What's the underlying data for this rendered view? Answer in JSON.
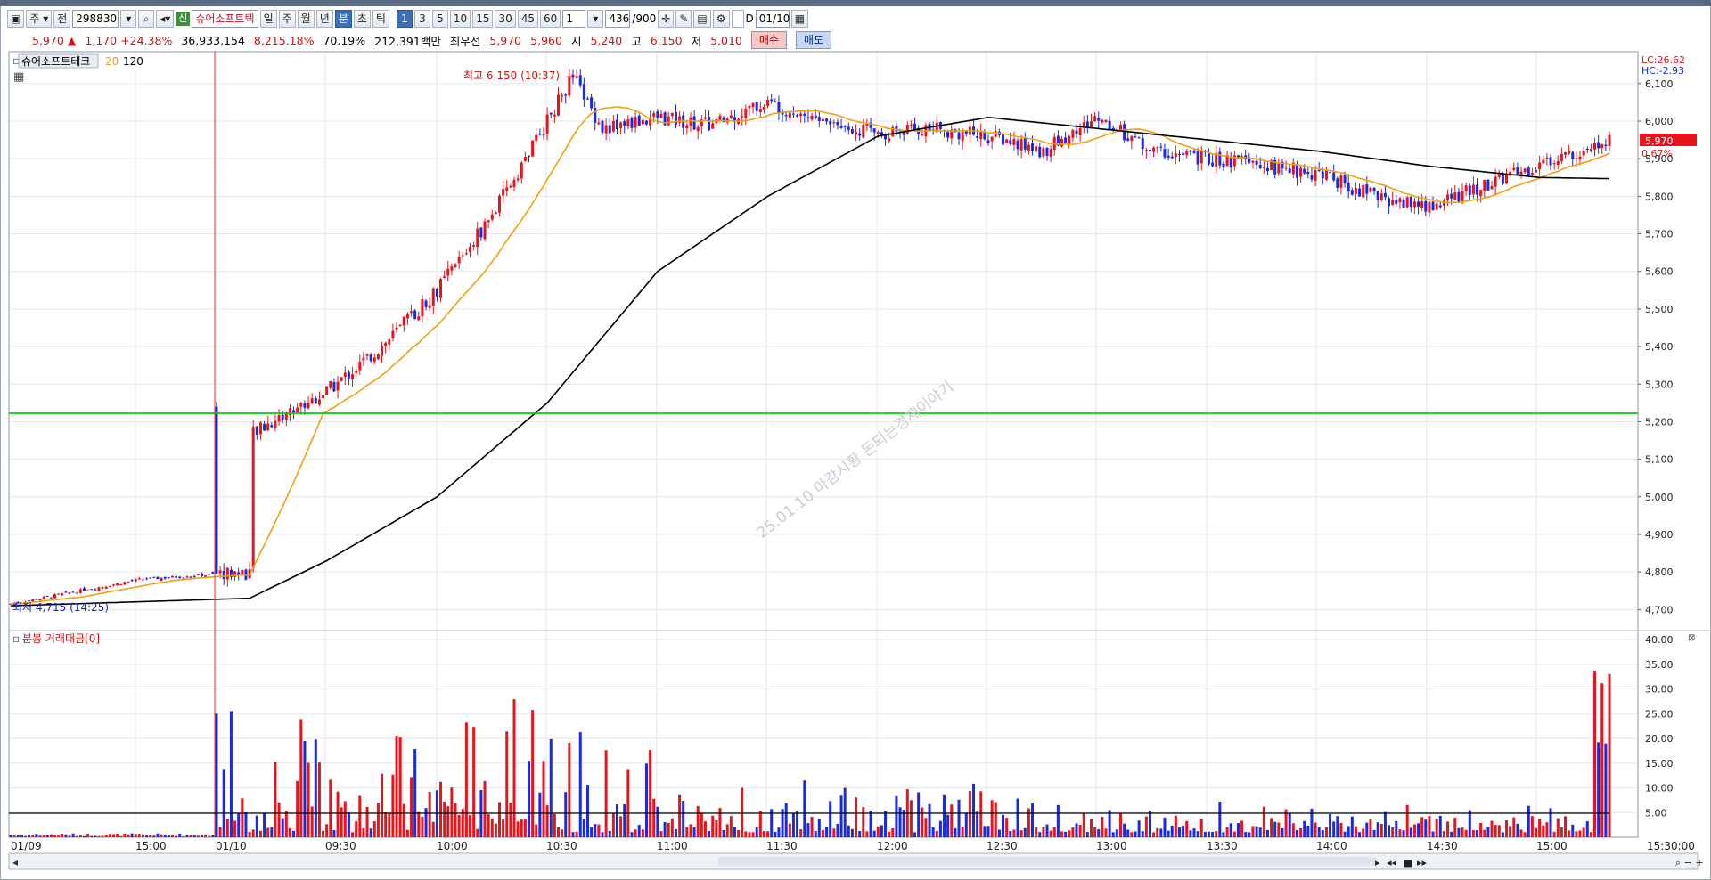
{
  "toolbar": {
    "market": "주",
    "prefix": "전",
    "code": "298830",
    "new_badge": "신",
    "stock_name": "슈어소프트텍",
    "periods": [
      "일",
      "주",
      "월",
      "년",
      "분",
      "초",
      "틱"
    ],
    "active_period": "분",
    "intervals": [
      "1",
      "3",
      "5",
      "10",
      "15",
      "30",
      "45",
      "60"
    ],
    "active_interval": "1",
    "multiplier": "1",
    "count": "436",
    "count_total": "/900",
    "date_check": "D",
    "date": "01/10"
  },
  "quote": {
    "price": "5,970",
    "arrow": "▲",
    "change": "1,170",
    "change_pct": "+24.38%",
    "volume": "36,933,154",
    "vol_pct": "8,215.18%",
    "turnover": "70.19%",
    "amount": "212,391백만",
    "best_label": "최우선",
    "ask": "5,970",
    "bid": "5,960",
    "open_label": "시",
    "open": "5,240",
    "high_label": "고",
    "high": "6,150",
    "low_label": "저",
    "low": "5,010",
    "buy_label": "매수",
    "sell_label": "매도"
  },
  "price_panel": {
    "legend_name": "슈어소프트테크",
    "ma1": "20",
    "ma2": "120",
    "lc": "LC:26.62",
    "hc": "HC:-2.93",
    "current_price": "5,970",
    "current_pct": "0.67%",
    "high_annot": "최고 6,150 (10:37)",
    "low_annot": "최저 4,715 (14:25)",
    "watermark": "25.01.10 마감시황 돈되는경제이야기",
    "y_ticks": [
      "6,100",
      "6,000",
      "5,900",
      "5,800",
      "5,700",
      "5,600",
      "5,500",
      "5,400",
      "5,300",
      "5,200",
      "5,100",
      "5,000",
      "4,900",
      "4,800",
      "4,700"
    ]
  },
  "volume_panel": {
    "title": "분봉 거래대금[0]",
    "y_ticks": [
      "40.00",
      "35.00",
      "30.00",
      "25.00",
      "20.00",
      "15.00",
      "10.00",
      "5.00"
    ]
  },
  "x_axis": {
    "labels": [
      "01/09",
      "15:00",
      "01/10",
      "09:30",
      "10:00",
      "10:30",
      "11:00",
      "11:30",
      "12:00",
      "12:30",
      "13:00",
      "13:30",
      "14:00",
      "14:30",
      "15:00",
      "15:30:00"
    ]
  },
  "colors": {
    "up": "#e8141c",
    "down": "#1a2ae0",
    "ma20": "#f0a010",
    "ma120": "#000000",
    "hline": "#00d000"
  },
  "chart_data": {
    "type": "candlestick",
    "interval": "1분",
    "ylim": [
      4690,
      6150
    ],
    "horizontal_line": 5240,
    "key_points": [
      {
        "time": "01/09 14:25",
        "price": 4715,
        "label": "최저"
      },
      {
        "time": "01/10 09:00",
        "open": 5240
      },
      {
        "time": "01/10 10:37",
        "price": 6150,
        "label": "최고"
      },
      {
        "time": "01/10 15:30",
        "close": 5970
      }
    ],
    "close_path": [
      {
        "time": "14:25",
        "price": 4715
      },
      {
        "time": "15:00",
        "price": 4780
      },
      {
        "time": "15:30",
        "price": 4800
      },
      {
        "time": "09:00",
        "price": 5100
      },
      {
        "time": "09:15",
        "price": 5200
      },
      {
        "time": "09:30",
        "price": 5280
      },
      {
        "time": "09:45",
        "price": 5400
      },
      {
        "time": "10:00",
        "price": 5550
      },
      {
        "time": "10:15",
        "price": 5750
      },
      {
        "time": "10:30",
        "price": 6000
      },
      {
        "time": "10:37",
        "price": 6120
      },
      {
        "time": "10:45",
        "price": 5980
      },
      {
        "time": "11:00",
        "price": 6010
      },
      {
        "time": "11:15",
        "price": 5990
      },
      {
        "time": "11:30",
        "price": 6050
      },
      {
        "time": "11:45",
        "price": 6000
      },
      {
        "time": "12:00",
        "price": 5970
      },
      {
        "time": "12:15",
        "price": 5980
      },
      {
        "time": "12:30",
        "price": 5960
      },
      {
        "time": "12:45",
        "price": 5920
      },
      {
        "time": "13:00",
        "price": 6010
      },
      {
        "time": "13:15",
        "price": 5920
      },
      {
        "time": "13:30",
        "price": 5900
      },
      {
        "time": "13:45",
        "price": 5880
      },
      {
        "time": "14:00",
        "price": 5860
      },
      {
        "time": "14:15",
        "price": 5800
      },
      {
        "time": "14:30",
        "price": 5770
      },
      {
        "time": "14:45",
        "price": 5830
      },
      {
        "time": "15:00",
        "price": 5880
      },
      {
        "time": "15:15",
        "price": 5940
      },
      {
        "time": "15:30",
        "price": 5970
      }
    ],
    "ma120_path": [
      {
        "time": "14:25",
        "price": 4710
      },
      {
        "time": "15:30",
        "price": 4730
      },
      {
        "time": "09:30",
        "price": 4830
      },
      {
        "time": "10:00",
        "price": 5000
      },
      {
        "time": "10:30",
        "price": 5250
      },
      {
        "time": "11:00",
        "price": 5600
      },
      {
        "time": "11:30",
        "price": 5800
      },
      {
        "time": "12:00",
        "price": 5960
      },
      {
        "time": "12:30",
        "price": 6010
      },
      {
        "time": "13:00",
        "price": 5980
      },
      {
        "time": "13:30",
        "price": 5950
      },
      {
        "time": "14:00",
        "price": 5920
      },
      {
        "time": "14:30",
        "price": 5880
      },
      {
        "time": "15:00",
        "price": 5850
      },
      {
        "time": "15:30",
        "price": 5845
      }
    ],
    "volume_y_range": [
      0,
      40
    ],
    "volume_baseline": 5
  }
}
